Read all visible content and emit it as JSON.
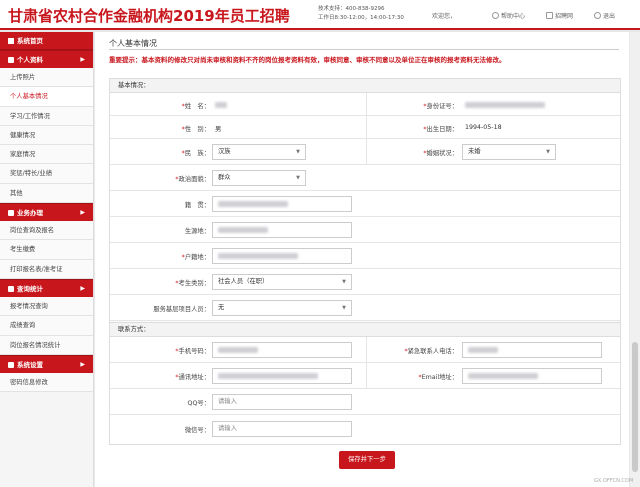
{
  "header": {
    "title": "甘肃省农村合作金融机构2019年员工招聘",
    "support_line": "技术支持：400-838-9296",
    "hours_line": "工作日8:30-12:00，14:00-17:30",
    "welcome": "欢迎您，",
    "help": "帮助中心",
    "recruit": "招聘网",
    "logout": "退出"
  },
  "sidebar": {
    "home": "系统首页",
    "sections": [
      {
        "label": "个人资料",
        "items": [
          "上传照片",
          "个人基本情况",
          "学习/工作情况",
          "健康情况",
          "家庭情况",
          "奖惩/特长/业绩",
          "其他"
        ]
      },
      {
        "label": "业务办理",
        "items": [
          "岗位查询及报名",
          "考生缴费",
          "打印报名表/准考证"
        ]
      },
      {
        "label": "查询统计",
        "items": [
          "报考情况查询",
          "成绩查询",
          "岗位报名情况统计"
        ]
      },
      {
        "label": "系统设置",
        "items": [
          "密码信息修改"
        ]
      }
    ],
    "active_item": "个人基本情况"
  },
  "main": {
    "section_title": "个人基本情况",
    "notice": "重要提示：基本资料的修改只对尚未审核和资料不齐的岗位报考资料有效，审核同意、审核不同意以及单位正在审核的报考资料无法修改。",
    "basic": {
      "heading": "基本情况：",
      "name_label": "姓　名：",
      "id_label": "身份证号：",
      "gender_label": "性　别：",
      "gender_value": "男",
      "birth_label": "出生日期：",
      "birth_value": "1994-05-18",
      "ethnicity_label": "民　族：",
      "ethnicity_value": "汉族",
      "marital_label": "婚姻状况：",
      "marital_value": "未婚",
      "political_label": "政治面貌：",
      "political_value": "群众",
      "native_label": "籍　贯：",
      "birthplace_label": "生源地：",
      "hukou_label": "户籍地：",
      "category_label": "考生类别：",
      "category_value": "社会人员（在职）",
      "grassroots_label": "服务基层项目人员：",
      "grassroots_value": "无"
    },
    "contact": {
      "heading": "联系方式：",
      "mobile_label": "手机号码：",
      "emergency_label": "紧急联系人电话：",
      "address_label": "通讯地址：",
      "email_label": "Email地址：",
      "qq_label": "QQ号：",
      "qq_placeholder": "请输入",
      "wechat_label": "微信号：",
      "wechat_placeholder": "请输入"
    },
    "save_button": "保存并下一步"
  },
  "watermark": "GX.OFFCN.COM",
  "colors": {
    "brand": "#c8161d"
  }
}
